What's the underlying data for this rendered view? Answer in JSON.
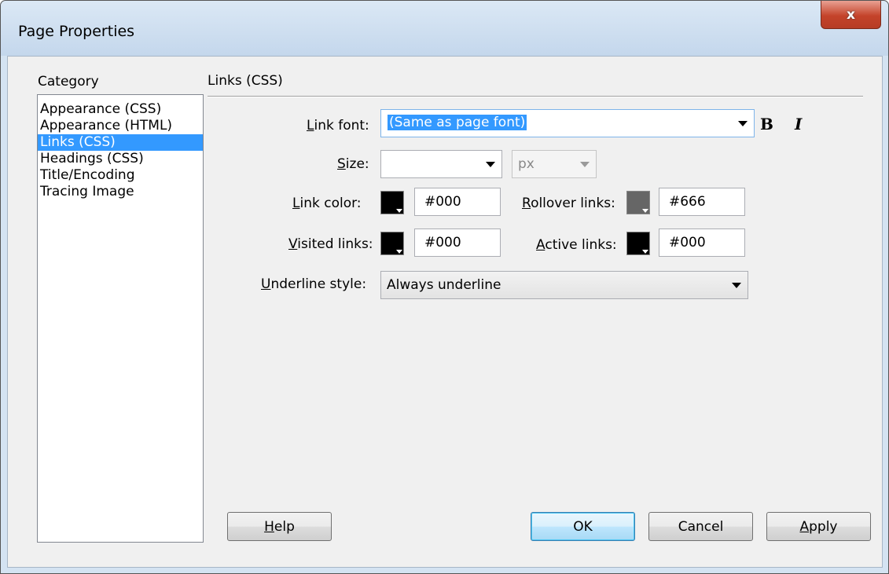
{
  "window": {
    "title": "Page Properties",
    "close_label": "x"
  },
  "category": {
    "label": "Category",
    "items": [
      {
        "label": "Appearance (CSS)",
        "selected": false
      },
      {
        "label": "Appearance (HTML)",
        "selected": false
      },
      {
        "label": "Links (CSS)",
        "selected": true
      },
      {
        "label": "Headings (CSS)",
        "selected": false
      },
      {
        "label": "Title/Encoding",
        "selected": false
      },
      {
        "label": "Tracing Image",
        "selected": false
      }
    ]
  },
  "panel": {
    "title": "Links (CSS)",
    "link_font": {
      "label_prefix": "L",
      "label_rest": "ink font:",
      "value": "(Same as page font)",
      "bold_label": "B",
      "italic_label": "I"
    },
    "size": {
      "label_prefix": "S",
      "label_rest": "ize:",
      "value": "",
      "unit_value": "px"
    },
    "link_color": {
      "label_prefix": "L",
      "label_rest": "ink color:",
      "color": "#000000",
      "value": "#000"
    },
    "rollover_links": {
      "label_prefix": "R",
      "label_rest": "ollover links:",
      "color": "#666666",
      "value": "#666"
    },
    "visited_links": {
      "label_prefix": "V",
      "label_rest": "isited links:",
      "color": "#000000",
      "value": "#000"
    },
    "active_links": {
      "label_prefix": "A",
      "label_rest": "ctive links:",
      "color": "#000000",
      "value": "#000"
    },
    "underline_style": {
      "label_prefix": "U",
      "label_rest": "nderline style:",
      "value": "Always underline"
    }
  },
  "buttons": {
    "help_prefix": "H",
    "help_rest": "elp",
    "ok": "OK",
    "cancel": "Cancel",
    "apply_prefix": "A",
    "apply_rest": "pply"
  }
}
